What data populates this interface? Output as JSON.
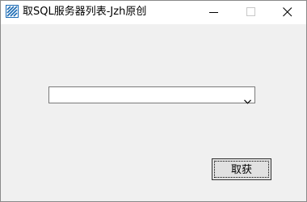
{
  "window": {
    "title": "取SQL服务器列表-Jzh原创",
    "icon": "app-icon"
  },
  "title_buttons": {
    "minimize": "minimize-icon",
    "maximize": "maximize-icon",
    "close": "close-icon"
  },
  "server_combo": {
    "value": "",
    "icon": "chevron-down-icon"
  },
  "cancel_button": {
    "label": "取获"
  },
  "colors": {
    "client_bg": "#f0f0f0",
    "titlebar_bg": "#ffffff",
    "icon_blue": "#1a6ab4"
  }
}
